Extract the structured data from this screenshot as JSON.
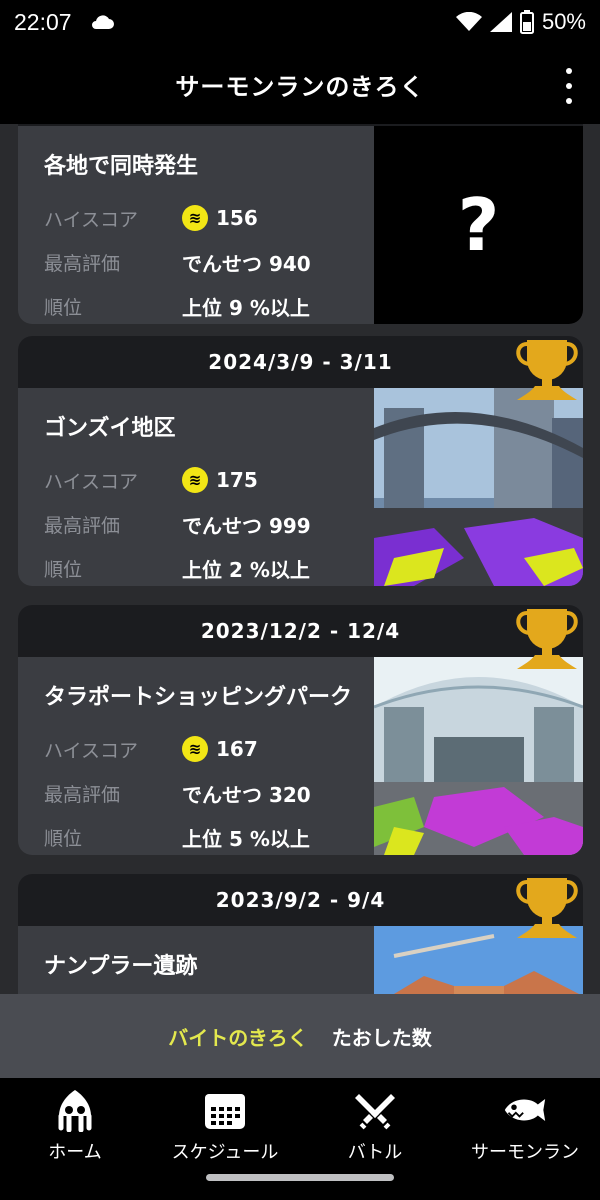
{
  "status_bar": {
    "time": "22:07",
    "battery": "50%"
  },
  "header": {
    "title": "サーモンランのきろく"
  },
  "labels": {
    "high_score": "ハイスコア",
    "best_rating": "最高評価",
    "rank": "順位"
  },
  "cards": [
    {
      "date": "",
      "stage": "各地で同時発生",
      "high_score": "156",
      "best_rating": "でんせつ 940",
      "rank": "上位 9 %以上",
      "image": "?"
    },
    {
      "date": "2024/3/9 - 3/11",
      "stage": "ゴンズイ地区",
      "high_score": "175",
      "best_rating": "でんせつ 999",
      "rank": "上位 2 %以上"
    },
    {
      "date": "2023/12/2 - 12/4",
      "stage": "タラポートショッピングパーク",
      "high_score": "167",
      "best_rating": "でんせつ 320",
      "rank": "上位 5 %以上"
    },
    {
      "date": "2023/9/2 - 9/4",
      "stage": "ナンプラー遺跡",
      "high_score": "",
      "best_rating": "",
      "rank": ""
    }
  ],
  "tabs": {
    "active": "バイトのきろく",
    "inactive": "たおした数"
  },
  "nav": [
    {
      "label": "ホーム",
      "icon": "squid-icon"
    },
    {
      "label": "スケジュール",
      "icon": "calendar-icon"
    },
    {
      "label": "バトル",
      "icon": "battle-icon"
    },
    {
      "label": "サーモンラン",
      "icon": "salmon-icon"
    }
  ],
  "colors": {
    "accent_yellow": "#e3e84e",
    "egg_yellow": "#f2e615",
    "trophy_gold": "#e3a81c",
    "card_bg": "#3b3d42"
  }
}
